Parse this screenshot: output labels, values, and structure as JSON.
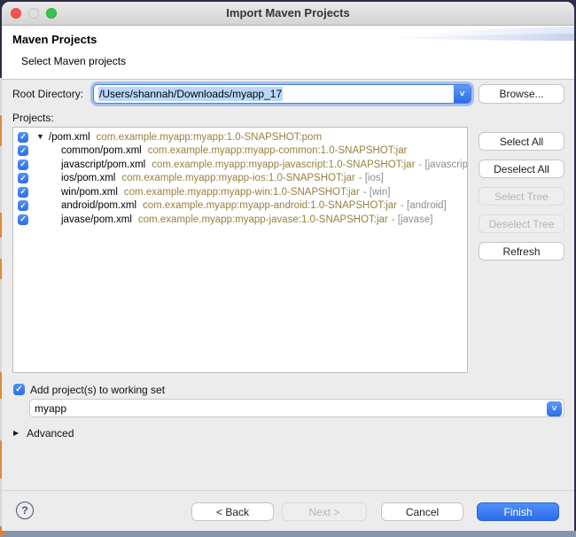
{
  "window": {
    "title": "Import Maven Projects"
  },
  "header": {
    "title": "Maven Projects",
    "subtitle": "Select Maven projects"
  },
  "icons": {
    "check": "✓",
    "disclosure_open": "▼",
    "disclosure_closed": "▶",
    "combo_chevron": "˅",
    "help": "?"
  },
  "root_directory": {
    "label": "Root Directory:",
    "value": "/Users/shannah/Downloads/myapp_17",
    "browse_label": "Browse..."
  },
  "projects": {
    "label": "Projects:",
    "items": [
      {
        "name": "/pom.xml",
        "coords": "com.example.myapp:myapp:1.0-SNAPSHOT:pom",
        "suffix": "",
        "checked": true,
        "expanded": true
      },
      {
        "name": "common/pom.xml",
        "coords": "com.example.myapp:myapp-common:1.0-SNAPSHOT:jar",
        "suffix": "",
        "checked": true
      },
      {
        "name": "javascript/pom.xml",
        "coords": "com.example.myapp:myapp-javascript:1.0-SNAPSHOT:jar",
        "suffix": "- [javascript]",
        "checked": true
      },
      {
        "name": "ios/pom.xml",
        "coords": "com.example.myapp:myapp-ios:1.0-SNAPSHOT:jar",
        "suffix": "- [ios]",
        "checked": true
      },
      {
        "name": "win/pom.xml",
        "coords": "com.example.myapp:myapp-win:1.0-SNAPSHOT:jar",
        "suffix": "- [win]",
        "checked": true
      },
      {
        "name": "android/pom.xml",
        "coords": "com.example.myapp:myapp-android:1.0-SNAPSHOT:jar",
        "suffix": "- [android]",
        "checked": true
      },
      {
        "name": "javase/pom.xml",
        "coords": "com.example.myapp:myapp-javase:1.0-SNAPSHOT:jar",
        "suffix": "- [javase]",
        "checked": true
      }
    ]
  },
  "side_buttons": [
    {
      "label": "Select All",
      "enabled": true
    },
    {
      "label": "Deselect All",
      "enabled": true
    },
    {
      "label": "Select Tree",
      "enabled": false
    },
    {
      "label": "Deselect Tree",
      "enabled": false
    },
    {
      "label": "Refresh",
      "enabled": true
    }
  ],
  "working_set": {
    "checkbox_label": "Add project(s) to working set",
    "checked": true,
    "value": "myapp"
  },
  "advanced": {
    "label": "Advanced"
  },
  "footer": {
    "help": "?",
    "back_label": "< Back",
    "next_label": "Next >",
    "cancel_label": "Cancel",
    "finish_label": "Finish"
  },
  "colors": {
    "accent_blue": "#3574f2",
    "coords_text": "#97803f",
    "suffix_text": "#8e8e93",
    "selection_highlight": "#b9d8fc",
    "window_bg": "#ececec",
    "bottom_edge": "#8a93ae"
  }
}
